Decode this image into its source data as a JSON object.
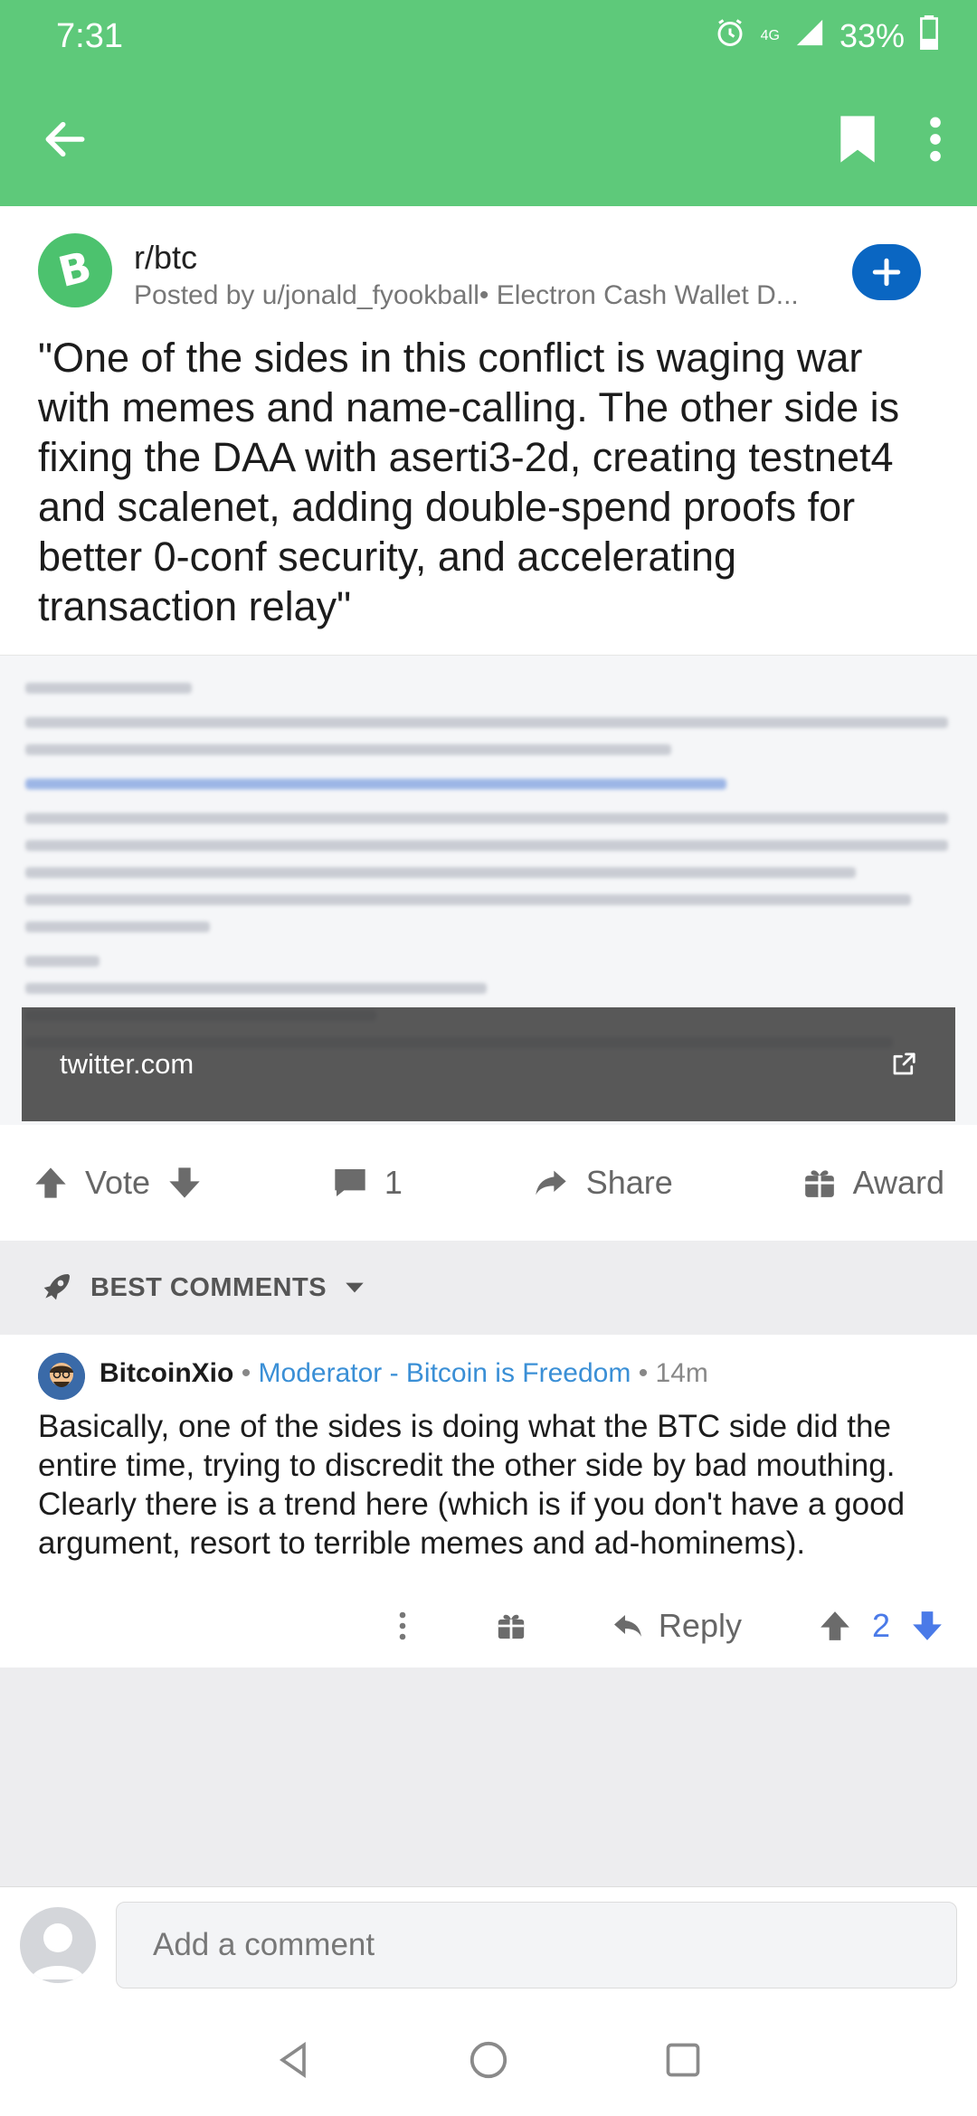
{
  "status_bar": {
    "time": "7:31",
    "network": "4G",
    "battery": "33%"
  },
  "post": {
    "subreddit": "r/btc",
    "posted_by": "Posted by u/jonald_fyookball• Electron Cash Wallet D...",
    "title": "\"One of the sides in this conflict is waging war with memes and name-calling. The other side is fixing the DAA with aserti3-2d, creating testnet4 and scalenet, adding double-spend proofs for better 0-conf security, and accelerating transaction relay\"",
    "link_domain": "twitter.com",
    "actions": {
      "vote": "Vote",
      "comments": "1",
      "share": "Share",
      "award": "Award"
    }
  },
  "comments_section": {
    "sort_label": "BEST COMMENTS"
  },
  "comment": {
    "author": "BitcoinXio",
    "flair": "Moderator - Bitcoin is Freedom",
    "time": "14m",
    "body": "Basically, one of the sides is doing what the BTC side did the entire time, trying to discredit the other side by bad mouthing. Clearly there is a trend here (which is if you don't have a good argument, resort to terrible memes and ad-hominems).",
    "reply": "Reply",
    "score": "2"
  },
  "composer": {
    "placeholder": "Add a comment"
  },
  "colors": {
    "header_green": "#5ec97a",
    "join_blue": "#0a66c2",
    "flair_blue": "#3a8fd6",
    "score_blue": "#4a7ae8"
  }
}
